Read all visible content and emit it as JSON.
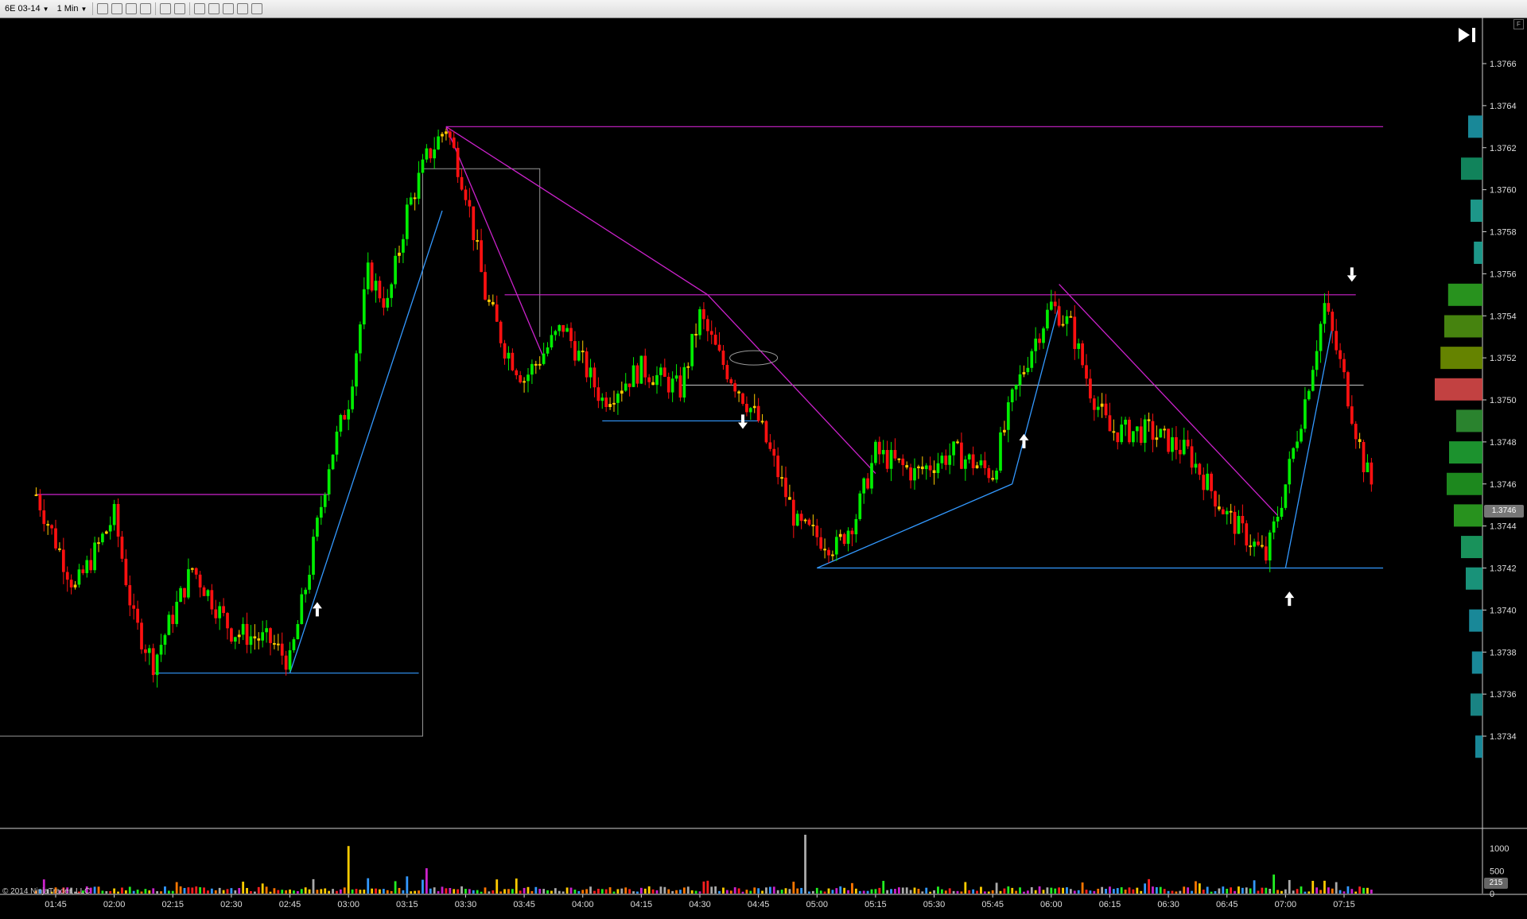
{
  "toolbar": {
    "instrument": "6E 03-14",
    "interval": "1 Min",
    "icons": [
      "bar-type-icon",
      "pencil-icon",
      "add-indicator-icon",
      "strategy-icon",
      "cursor-icon",
      "zoom-icon",
      "data-box-icon",
      "chart-properties-icon",
      "chart-trader-icon",
      "cash-icon",
      "window-icon"
    ]
  },
  "price_axis": {
    "labels": [
      "1.3766",
      "1.3764",
      "1.3762",
      "1.3760",
      "1.3758",
      "1.3756",
      "1.3754",
      "1.3752",
      "1.3750",
      "1.3748",
      "1.3746",
      "1.3744",
      "1.3742",
      "1.3740",
      "1.3738",
      "1.3736",
      "1.3734"
    ],
    "current_price": "1.3746"
  },
  "volume_axis": {
    "labels": [
      "1000",
      "500",
      "0"
    ],
    "current_volume": "215"
  },
  "time_axis": {
    "labels": [
      "01:45",
      "02:00",
      "02:15",
      "02:30",
      "02:45",
      "03:00",
      "03:15",
      "03:30",
      "03:45",
      "04:00",
      "04:15",
      "04:30",
      "04:45",
      "05:00",
      "05:15",
      "05:30",
      "05:45",
      "06:00",
      "06:15",
      "06:30",
      "06:45",
      "07:00",
      "07:15"
    ]
  },
  "copyright": "© 2014 NinjaTrader, LLC",
  "colors": {
    "up": "#00ee00",
    "down": "#ff1010",
    "neutral": "#ffcc00",
    "fib_line": "#cc22cc",
    "trend_line": "#3399ff",
    "rect": "#999999"
  },
  "chart_data": {
    "type": "candlestick",
    "y_range": [
      1.3732,
      1.3768
    ],
    "x_range": [
      "01:40",
      "07:25"
    ],
    "volume_range": [
      0,
      1000
    ],
    "price_series": [
      {
        "time": "01:40",
        "price": 1.37455
      },
      {
        "time": "01:50",
        "price": 1.3741
      },
      {
        "time": "02:00",
        "price": 1.37445
      },
      {
        "time": "02:05",
        "price": 1.37395
      },
      {
        "time": "02:10",
        "price": 1.37375
      },
      {
        "time": "02:20",
        "price": 1.3742
      },
      {
        "time": "02:30",
        "price": 1.3739
      },
      {
        "time": "02:40",
        "price": 1.37385
      },
      {
        "time": "02:45",
        "price": 1.37375
      },
      {
        "time": "02:50",
        "price": 1.3742
      },
      {
        "time": "02:55",
        "price": 1.3747
      },
      {
        "time": "03:00",
        "price": 1.375
      },
      {
        "time": "03:05",
        "price": 1.3756
      },
      {
        "time": "03:10",
        "price": 1.37545
      },
      {
        "time": "03:15",
        "price": 1.3759
      },
      {
        "time": "03:20",
        "price": 1.37615
      },
      {
        "time": "03:25",
        "price": 1.3763
      },
      {
        "time": "03:30",
        "price": 1.376
      },
      {
        "time": "03:35",
        "price": 1.3755
      },
      {
        "time": "03:40",
        "price": 1.37525
      },
      {
        "time": "03:45",
        "price": 1.3751
      },
      {
        "time": "03:55",
        "price": 1.37535
      },
      {
        "time": "04:05",
        "price": 1.375
      },
      {
        "time": "04:15",
        "price": 1.37515
      },
      {
        "time": "04:25",
        "price": 1.37505
      },
      {
        "time": "04:30",
        "price": 1.3754
      },
      {
        "time": "04:35",
        "price": 1.3752
      },
      {
        "time": "04:40",
        "price": 1.37505
      },
      {
        "time": "04:45",
        "price": 1.3749
      },
      {
        "time": "04:50",
        "price": 1.37465
      },
      {
        "time": "04:55",
        "price": 1.3744
      },
      {
        "time": "05:00",
        "price": 1.37435
      },
      {
        "time": "05:05",
        "price": 1.3743
      },
      {
        "time": "05:10",
        "price": 1.37445
      },
      {
        "time": "05:15",
        "price": 1.37475
      },
      {
        "time": "05:25",
        "price": 1.37465
      },
      {
        "time": "05:35",
        "price": 1.37475
      },
      {
        "time": "05:45",
        "price": 1.37465
      },
      {
        "time": "05:50",
        "price": 1.375
      },
      {
        "time": "05:55",
        "price": 1.37525
      },
      {
        "time": "06:00",
        "price": 1.37545
      },
      {
        "time": "06:05",
        "price": 1.37535
      },
      {
        "time": "06:10",
        "price": 1.37505
      },
      {
        "time": "06:15",
        "price": 1.37485
      },
      {
        "time": "06:25",
        "price": 1.37485
      },
      {
        "time": "06:35",
        "price": 1.37475
      },
      {
        "time": "06:45",
        "price": 1.37445
      },
      {
        "time": "06:50",
        "price": 1.37435
      },
      {
        "time": "06:55",
        "price": 1.37425
      },
      {
        "time": "07:00",
        "price": 1.3746
      },
      {
        "time": "07:05",
        "price": 1.375
      },
      {
        "time": "07:10",
        "price": 1.37545
      },
      {
        "time": "07:15",
        "price": 1.3751
      },
      {
        "time": "07:20",
        "price": 1.3747
      },
      {
        "time": "07:22",
        "price": 1.3746
      }
    ],
    "volume_spikes": [
      {
        "time": "03:00",
        "volume": 1050
      },
      {
        "time": "03:20",
        "volume": 560
      },
      {
        "time": "03:15",
        "volume": 380
      },
      {
        "time": "04:57",
        "volume": 1300
      },
      {
        "time": "06:57",
        "volume": 420
      }
    ],
    "volume_profile": [
      {
        "price": 1.3763,
        "size": 0.3,
        "color": "#1a8fa0"
      },
      {
        "price": 1.3761,
        "size": 0.45,
        "color": "#128a60"
      },
      {
        "price": 1.3759,
        "size": 0.25,
        "color": "#1f9f90"
      },
      {
        "price": 1.3757,
        "size": 0.18,
        "color": "#1f9f90"
      },
      {
        "price": 1.3755,
        "size": 0.72,
        "color": "#2a9a20"
      },
      {
        "price": 1.37535,
        "size": 0.8,
        "color": "#4a8a10"
      },
      {
        "price": 1.3752,
        "size": 0.88,
        "color": "#6a8a00"
      },
      {
        "price": 1.37505,
        "size": 1.0,
        "color": "#cc4444"
      },
      {
        "price": 1.3749,
        "size": 0.55,
        "color": "#2c8a30"
      },
      {
        "price": 1.37475,
        "size": 0.7,
        "color": "#1e9a30"
      },
      {
        "price": 1.3746,
        "size": 0.75,
        "color": "#1f8f20"
      },
      {
        "price": 1.37445,
        "size": 0.6,
        "color": "#2a9a20"
      },
      {
        "price": 1.3743,
        "size": 0.45,
        "color": "#1a9a60"
      },
      {
        "price": 1.37415,
        "size": 0.35,
        "color": "#1a9a80"
      },
      {
        "price": 1.37395,
        "size": 0.28,
        "color": "#1a8fa0"
      },
      {
        "price": 1.37375,
        "size": 0.22,
        "color": "#1a8fa0"
      },
      {
        "price": 1.37355,
        "size": 0.25,
        "color": "#1a8a8a"
      },
      {
        "price": 1.37335,
        "size": 0.15,
        "color": "#1a8fa0"
      }
    ],
    "horizontal_lines": [
      {
        "price": 1.3763,
        "from": "03:25",
        "to": "07:25",
        "color": "#cc22cc"
      },
      {
        "price": 1.3755,
        "from": "03:40",
        "to": "07:18",
        "color": "#cc22cc"
      },
      {
        "price": 1.37455,
        "from": "01:40",
        "to": "02:55",
        "color": "#cc22cc"
      },
      {
        "price": 1.37507,
        "from": "04:25",
        "to": "07:20",
        "color": "#aaaaaa"
      },
      {
        "price": 1.3737,
        "from": "02:10",
        "to": "03:18",
        "color": "#3399ff"
      },
      {
        "price": 1.3749,
        "from": "04:05",
        "to": "04:45",
        "color": "#3399ff"
      },
      {
        "price": 1.3742,
        "from": "05:00",
        "to": "07:25",
        "color": "#3399ff"
      }
    ],
    "arrows": [
      {
        "time": "02:52",
        "price": 1.374,
        "dir": "up"
      },
      {
        "time": "04:41",
        "price": 1.3749,
        "dir": "down"
      },
      {
        "time": "05:53",
        "price": 1.3748,
        "dir": "up"
      },
      {
        "time": "07:01",
        "price": 1.37405,
        "dir": "up"
      },
      {
        "time": "07:17",
        "price": 1.3756,
        "dir": "down"
      }
    ]
  }
}
